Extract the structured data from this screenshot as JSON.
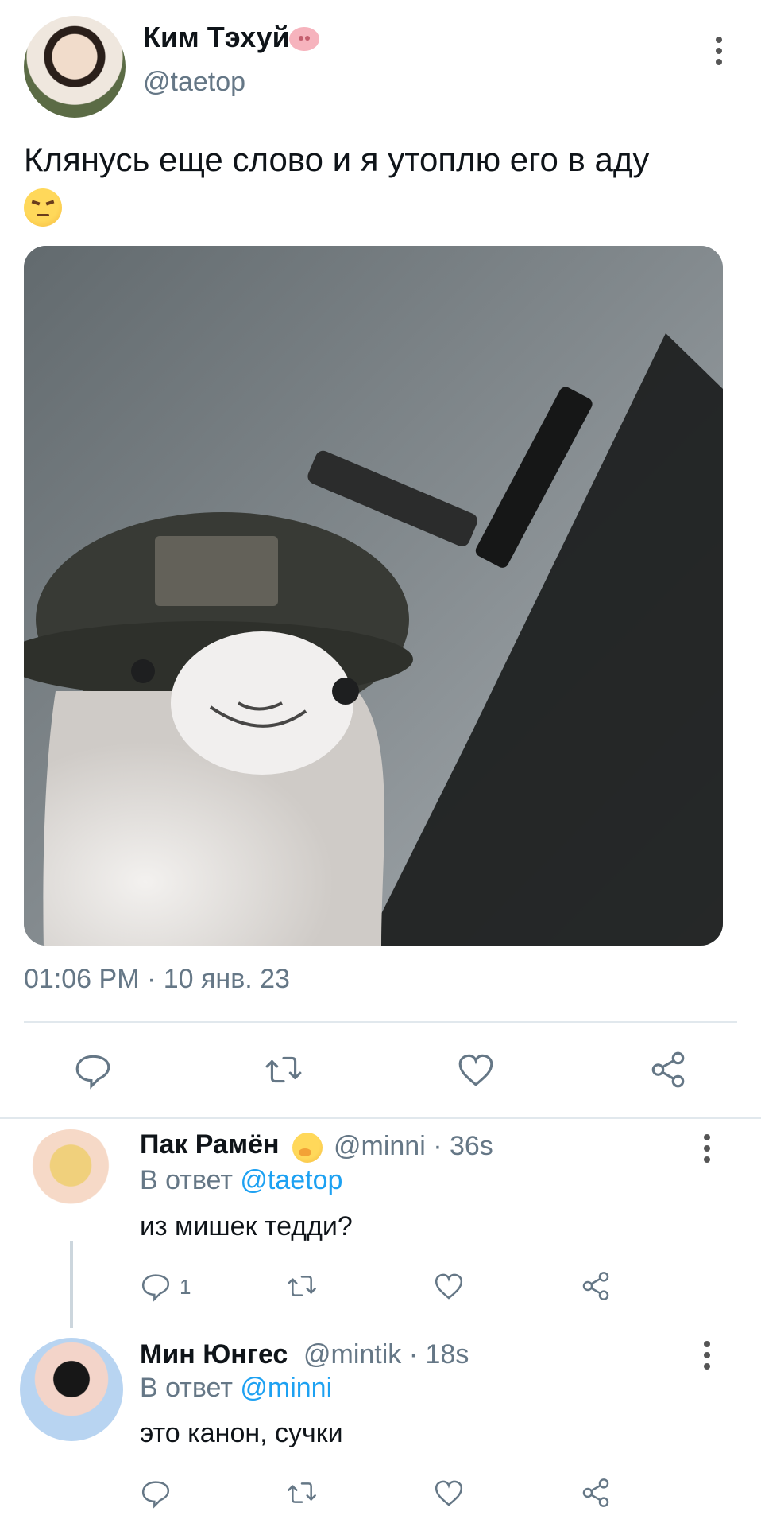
{
  "main_tweet": {
    "author_name": "Ким Тэхуй",
    "author_badge_icon": "pig-face-icon",
    "author_handle": "@taetop",
    "text": "Клянусь еще слово и я утоплю его в аду",
    "emoji": "angry-face-icon",
    "timestamp": "01:06 PM · 10 янв. 23",
    "actions": {
      "reply_icon": "reply-icon",
      "retweet_icon": "retweet-icon",
      "like_icon": "heart-icon",
      "share_icon": "share-icon"
    }
  },
  "replies": [
    {
      "author_name": "Пак Рамён",
      "author_emoji": "face-with-hand-over-mouth-icon",
      "author_handle": "@minni · 36s",
      "reply_to_prefix": "В ответ",
      "reply_to_handle": "@taetop",
      "text": "из мишек тедди?",
      "reply_count": "1"
    },
    {
      "author_name": "Мин Юнгес",
      "author_handle": "@mintik · 18s",
      "reply_to_prefix": "В ответ",
      "reply_to_handle": "@minni",
      "text": "это канон, сучки",
      "reply_count": ""
    }
  ],
  "colors": {
    "link": "#1da1f2",
    "muted": "#657786",
    "divider": "#e1e8ed",
    "text": "#0f1419"
  }
}
